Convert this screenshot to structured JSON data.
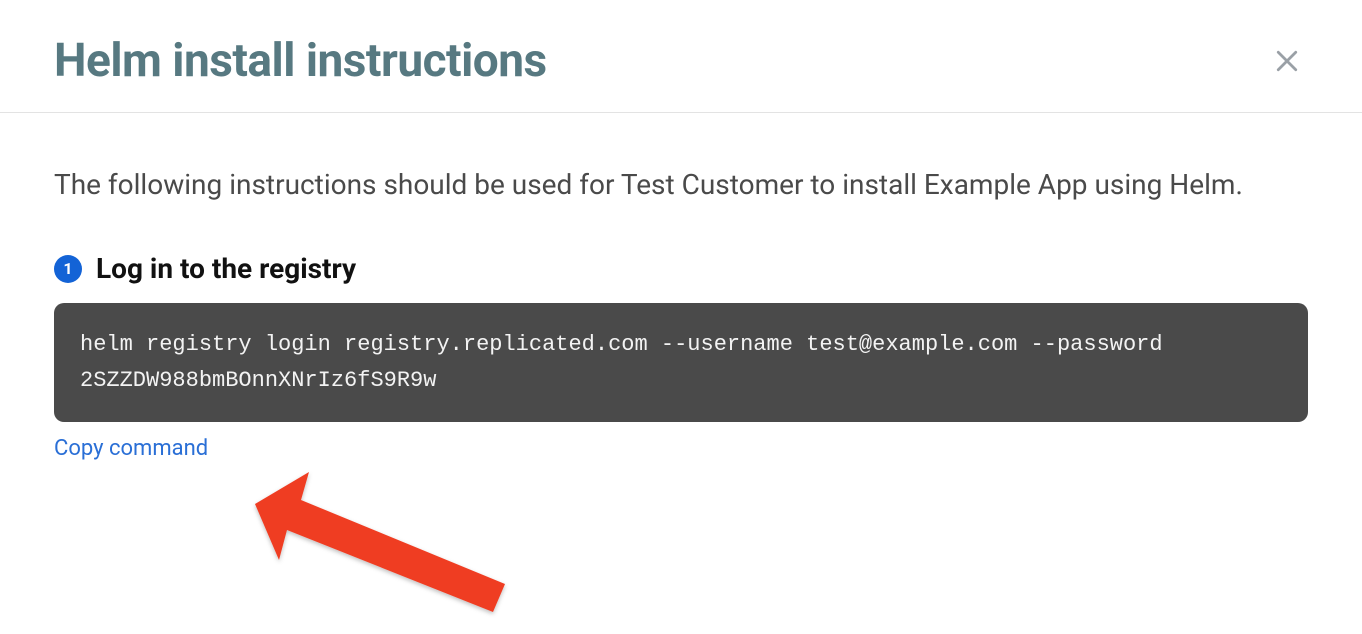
{
  "modal": {
    "title": "Helm install instructions"
  },
  "intro": "The following instructions should be used for Test Customer to install Example App using Helm.",
  "step": {
    "number": "1",
    "title": "Log in to the registry",
    "command": "helm registry login registry.replicated.com --username test@example.com --password 2SZZDW988bmBOnnXNrIz6fS9R9w",
    "copy_label": "Copy command"
  }
}
